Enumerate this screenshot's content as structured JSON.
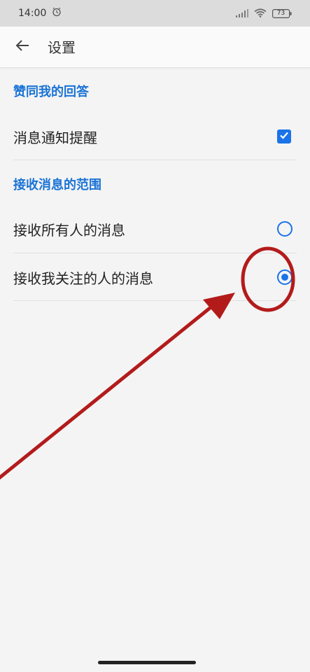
{
  "status_bar": {
    "time": "14:00",
    "battery": "73",
    "icons": [
      "alarm-icon",
      "signal-icon",
      "wifi-icon",
      "battery-icon"
    ]
  },
  "app_bar": {
    "title": "设置",
    "back_icon": "arrow-left-icon"
  },
  "sections": {
    "likes_header": "赞同我的回答",
    "notify_label": "消息通知提醒",
    "notify_checked": true,
    "range_header": "接收消息的范围",
    "range_options": [
      {
        "label": "接收所有人的消息",
        "selected": false
      },
      {
        "label": "接收我关注的人的消息",
        "selected": true
      }
    ]
  },
  "colors": {
    "accent": "#1a73e8",
    "header_text": "#1a73d6",
    "annotation": "#b31b1b"
  }
}
